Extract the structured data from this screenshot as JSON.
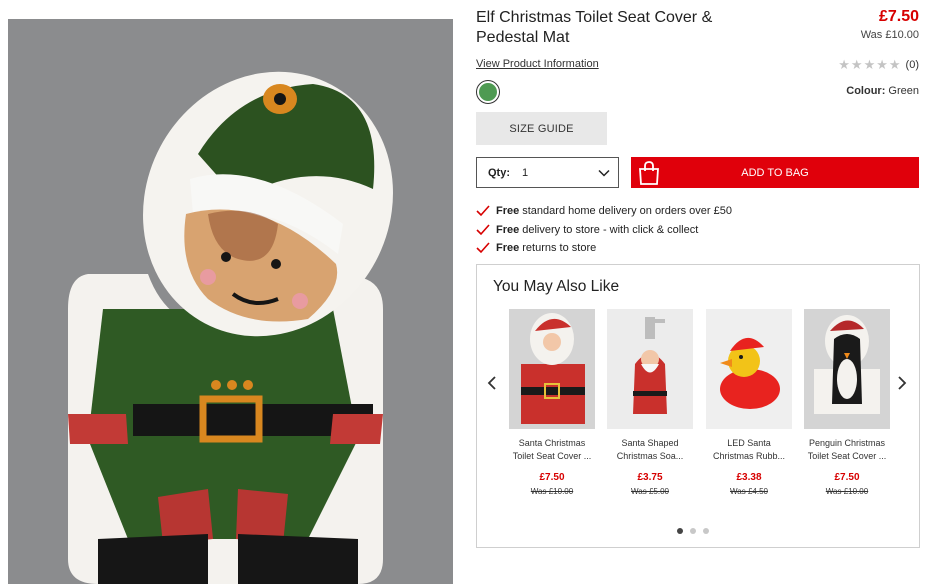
{
  "product": {
    "title": "Elf Christmas Toilet Seat Cover & Pedestal Mat",
    "price": "£7.50",
    "was_price": "Was £10.00",
    "view_info_link": "View Product Information",
    "rating_count": "(0)",
    "rating_value": 0,
    "rating_max": 5,
    "colour_label": "Colour:",
    "colour_value": "Green",
    "swatch_color": "#4e9a52",
    "size_guide": "SIZE GUIDE",
    "qty_label": "Qty:",
    "qty_value": "1",
    "add_to_bag": "ADD TO BAG"
  },
  "benefits": [
    {
      "bold": "Free",
      "text": "standard home delivery on orders over £50"
    },
    {
      "bold": "Free",
      "text": "delivery to store - with click & collect"
    },
    {
      "bold": "Free",
      "text": "returns to store"
    }
  ],
  "recommendations": {
    "title": "You May Also Like",
    "items": [
      {
        "name": "Santa Christmas Toilet Seat Cover ...",
        "price": "£7.50",
        "was": "Was £10.00"
      },
      {
        "name": "Santa Shaped Christmas Soa...",
        "price": "£3.75",
        "was": "Was £5.00"
      },
      {
        "name": "LED Santa Christmas Rubb...",
        "price": "£3.38",
        "was": "Was £4.50"
      },
      {
        "name": "Penguin Christmas Toilet Seat Cover ...",
        "price": "£7.50",
        "was": "Was £10.00"
      }
    ],
    "pages": 3,
    "active_page": 1
  },
  "colors": {
    "accent": "#e0000b",
    "price_red": "#d70000"
  },
  "icons": {
    "prev": "chevron-left-icon",
    "next": "chevron-right-icon",
    "bag": "shopping-bag-icon",
    "tick": "checkmark-icon",
    "dropdown": "chevron-down-icon",
    "star": "star-icon"
  }
}
